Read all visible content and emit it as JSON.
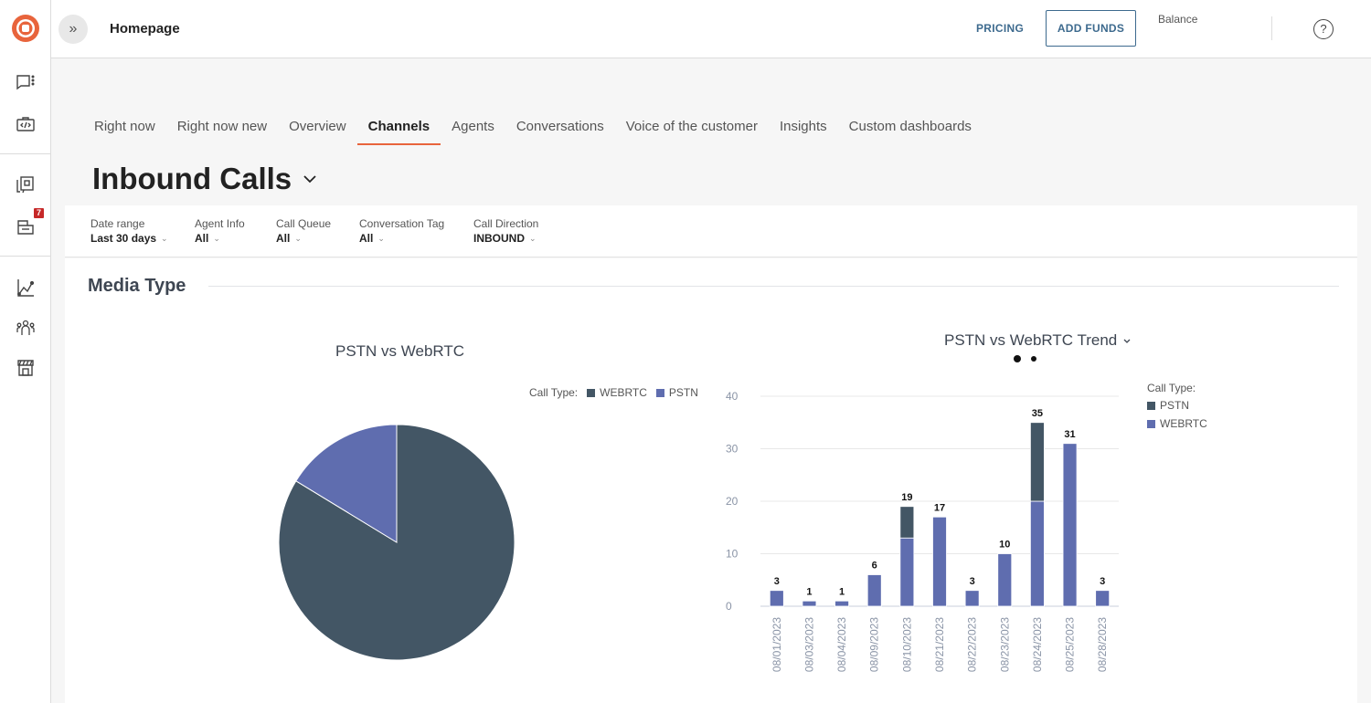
{
  "sidebar": {
    "items": [
      {
        "icon": "chat-dots-icon"
      },
      {
        "icon": "api-briefcase-icon"
      },
      {
        "icon": "message-copy-icon"
      },
      {
        "icon": "inbox-tasks-icon",
        "badge": "7"
      },
      {
        "icon": "analytics-chart-icon"
      },
      {
        "icon": "team-users-icon"
      },
      {
        "icon": "storefront-icon"
      }
    ]
  },
  "topbar": {
    "title": "Homepage",
    "pricing_label": "PRICING",
    "add_funds_label": "ADD FUNDS",
    "balance_label": "Balance",
    "help_label": "?"
  },
  "tabs": [
    {
      "label": "Right now",
      "active": false
    },
    {
      "label": "Right now new",
      "active": false
    },
    {
      "label": "Overview",
      "active": false
    },
    {
      "label": "Channels",
      "active": true
    },
    {
      "label": "Agents",
      "active": false
    },
    {
      "label": "Conversations",
      "active": false
    },
    {
      "label": "Voice of the customer",
      "active": false
    },
    {
      "label": "Insights",
      "active": false
    },
    {
      "label": "Custom dashboards",
      "active": false
    }
  ],
  "page": {
    "title": "Inbound Calls"
  },
  "filters": [
    {
      "label": "Date range",
      "value": "Last 30 days"
    },
    {
      "label": "Agent Info",
      "value": "All"
    },
    {
      "label": "Call Queue",
      "value": "All"
    },
    {
      "label": "Conversation Tag",
      "value": "All"
    },
    {
      "label": "Call Direction",
      "value": "INBOUND"
    }
  ],
  "section": {
    "title": "Media Type"
  },
  "colors": {
    "webrtc": "#5f6daf",
    "pstn": "#435665",
    "accent": "#e8643c",
    "link": "#3d6a8e"
  },
  "chart_data": [
    {
      "type": "pie",
      "title": "PSTN vs WebRTC",
      "legend_title": "Call Type:",
      "legend": [
        "WEBRTC",
        "PSTN"
      ],
      "legend_placement": "top-right",
      "slices": [
        {
          "name": "WEBRTC",
          "value": 108,
          "color": "#435665"
        },
        {
          "name": "PSTN",
          "value": 21,
          "color": "#5f6daf"
        }
      ]
    },
    {
      "type": "bar",
      "stacked": true,
      "title": "PSTN vs WebRTC Trend",
      "legend_title": "Call Type:",
      "legend_placement": "right",
      "categories": [
        "08/01/2023",
        "08/03/2023",
        "08/04/2023",
        "08/09/2023",
        "08/10/2023",
        "08/21/2023",
        "08/22/2023",
        "08/23/2023",
        "08/24/2023",
        "08/25/2023",
        "08/28/2023"
      ],
      "series": [
        {
          "name": "WEBRTC",
          "color": "#5f6daf",
          "values": [
            3,
            1,
            1,
            6,
            13,
            17,
            3,
            10,
            20,
            31,
            3
          ]
        },
        {
          "name": "PSTN",
          "color": "#435665",
          "values": [
            0,
            0,
            0,
            0,
            6,
            0,
            0,
            0,
            15,
            0,
            0
          ]
        }
      ],
      "totals": [
        3,
        1,
        1,
        6,
        19,
        17,
        3,
        10,
        35,
        31,
        3
      ],
      "legend": [
        "PSTN",
        "WEBRTC"
      ],
      "yticks": [
        0,
        10,
        20,
        30,
        40
      ],
      "ylim": [
        0,
        40
      ],
      "grid": true
    }
  ]
}
